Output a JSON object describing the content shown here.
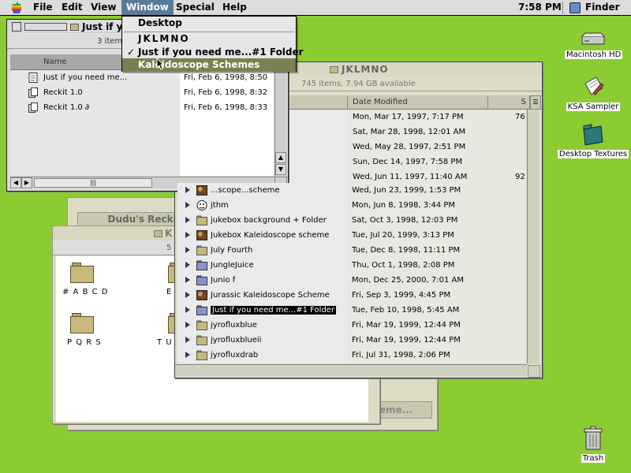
{
  "menubar": {
    "items": [
      "File",
      "Edit",
      "View",
      "Window",
      "Special",
      "Help"
    ],
    "clock": "7:58 PM",
    "app_name": "Finder"
  },
  "window_menu": {
    "desktop": "Desktop",
    "item1": "JKLMNO",
    "item2": "Just if you need me...#1 Folder",
    "item3": "Kaleidoscope Schemes"
  },
  "win_just": {
    "title": "Just if yo",
    "info": "3 item",
    "col_name": "Name",
    "rows": [
      {
        "name": "Just if you need me...",
        "date": "Fri, Feb 6, 1998, 8:50"
      },
      {
        "name": "Reckit 1.0",
        "date": "Fri, Feb 6, 1998, 8:32"
      },
      {
        "name": "Reckit 1.0 ∂",
        "date": "Fri, Feb 6, 1998, 8:33"
      }
    ]
  },
  "win_jklmno": {
    "title": "JKLMNO",
    "info": "745 items, 7.94 GB available",
    "col_date": "Date Modified",
    "col_size": "S",
    "top_dates": [
      {
        "date": "Mon, Mar 17, 1997, 7:17 PM",
        "size": "76"
      },
      {
        "date": "Sat, Mar 28, 1998, 12:01 AM",
        "size": ""
      },
      {
        "date": "Wed, May 28, 1997, 2:51 PM",
        "size": ""
      },
      {
        "date": "Sun, Dec 14, 1997, 7:58 PM",
        "size": ""
      },
      {
        "date": "Wed, Jun 11, 1997, 11:40 AM",
        "size": "92"
      }
    ],
    "rows": [
      {
        "name": "...scope...scheme",
        "date": "Wed, Jun 23, 1999, 1:53 PM",
        "icon": "kscheme"
      },
      {
        "name": "jthm",
        "date": "Mon, Jun 8, 1998, 3:44 PM",
        "icon": "face"
      },
      {
        "name": "jukebox background + Folder",
        "date": "Sat, Oct 3, 1998, 12:03 PM",
        "icon": "folder"
      },
      {
        "name": "Jukebox Kaleidoscope scheme",
        "date": "Tue, Jul 20, 1999, 3:13 PM",
        "icon": "kscheme"
      },
      {
        "name": "July Fourth",
        "date": "Tue, Dec 8, 1998, 11:11 PM",
        "icon": "folder"
      },
      {
        "name": "JungleJuice",
        "date": "Thu, Oct 1, 1998, 2:08 PM",
        "icon": "folder-blue"
      },
      {
        "name": "Junio f",
        "date": "Mon, Dec 25, 2000, 7:01 AM",
        "icon": "folder-blue"
      },
      {
        "name": "Jurassic Kaleidoscope Scheme",
        "date": "Fri, Sep 3, 1999, 4:45 PM",
        "icon": "kscheme"
      },
      {
        "name": "Just if you need me...#1 Folder",
        "date": "Tue, Feb 10, 1998, 5:45 AM",
        "icon": "folder-blue",
        "selected": true
      },
      {
        "name": "jyrofluxblue",
        "date": "Fri, Mar 19, 1999, 12:44 PM",
        "icon": "folder"
      },
      {
        "name": "jyrofluxblueii",
        "date": "Fri, Mar 19, 1999, 12:44 PM",
        "icon": "folder"
      },
      {
        "name": "jyrofluxdrab",
        "date": "Fri, Jul 31, 1998, 2:06 PM",
        "icon": "folder"
      }
    ]
  },
  "win_dudu": {
    "title": "Dudu's Reckit",
    "button_partial": "eme..."
  },
  "win_k": {
    "title": "K",
    "info": "5",
    "icons": [
      {
        "label": "# A B C D"
      },
      {
        "label": "E"
      },
      {
        "label": "P Q R S"
      },
      {
        "label": "T U V"
      }
    ]
  },
  "desktop_icons": [
    {
      "label": "Macintosh HD",
      "icon": "harddisk-icon"
    },
    {
      "label": "KSA Sampler",
      "icon": "document-icon"
    },
    {
      "label": "Desktop Textures",
      "icon": "folder-icon"
    },
    {
      "label": "Trash",
      "icon": "trash-icon"
    }
  ],
  "colors": {
    "desktop": "#8ccc33",
    "menu_highlight": "#5a7a9a",
    "dropdown_selected": "#7a8050"
  }
}
